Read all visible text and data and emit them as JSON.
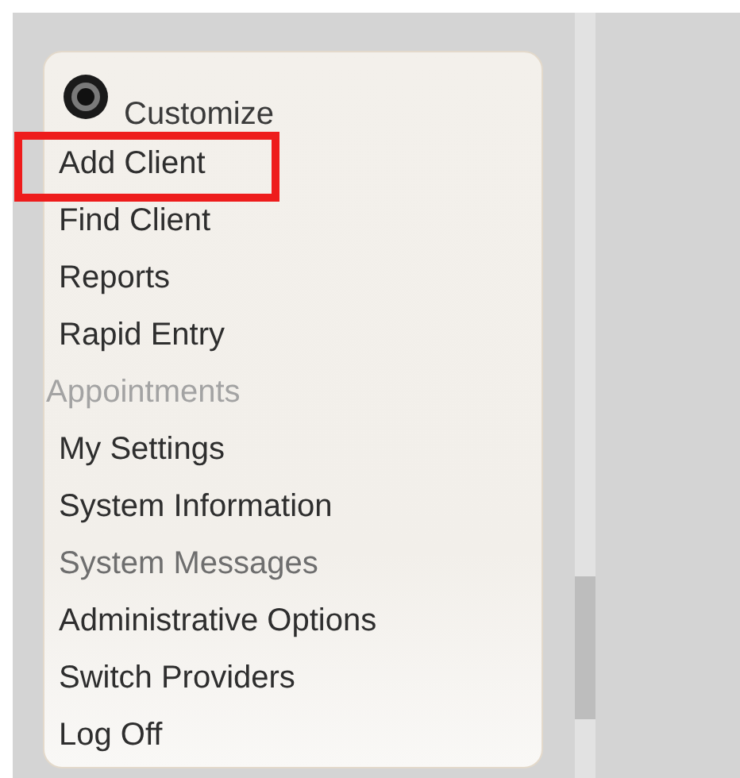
{
  "menu": {
    "header": {
      "label": "Customize"
    },
    "items": [
      {
        "label": "Add Client",
        "kind": "link",
        "highlighted": true
      },
      {
        "label": "Find Client",
        "kind": "link",
        "highlighted": false
      },
      {
        "label": "Reports",
        "kind": "link",
        "highlighted": false
      },
      {
        "label": "Rapid Entry",
        "kind": "link",
        "highlighted": false
      },
      {
        "label": "Appointments",
        "kind": "disabled",
        "highlighted": false
      },
      {
        "label": "My Settings",
        "kind": "link",
        "highlighted": false
      },
      {
        "label": "System Information",
        "kind": "link",
        "highlighted": false
      },
      {
        "label": "System Messages",
        "kind": "muted",
        "highlighted": false
      },
      {
        "label": "Administrative Options",
        "kind": "link",
        "highlighted": false
      },
      {
        "label": "Switch Providers",
        "kind": "link",
        "highlighted": false
      },
      {
        "label": "Log Off",
        "kind": "link",
        "highlighted": false
      }
    ]
  }
}
